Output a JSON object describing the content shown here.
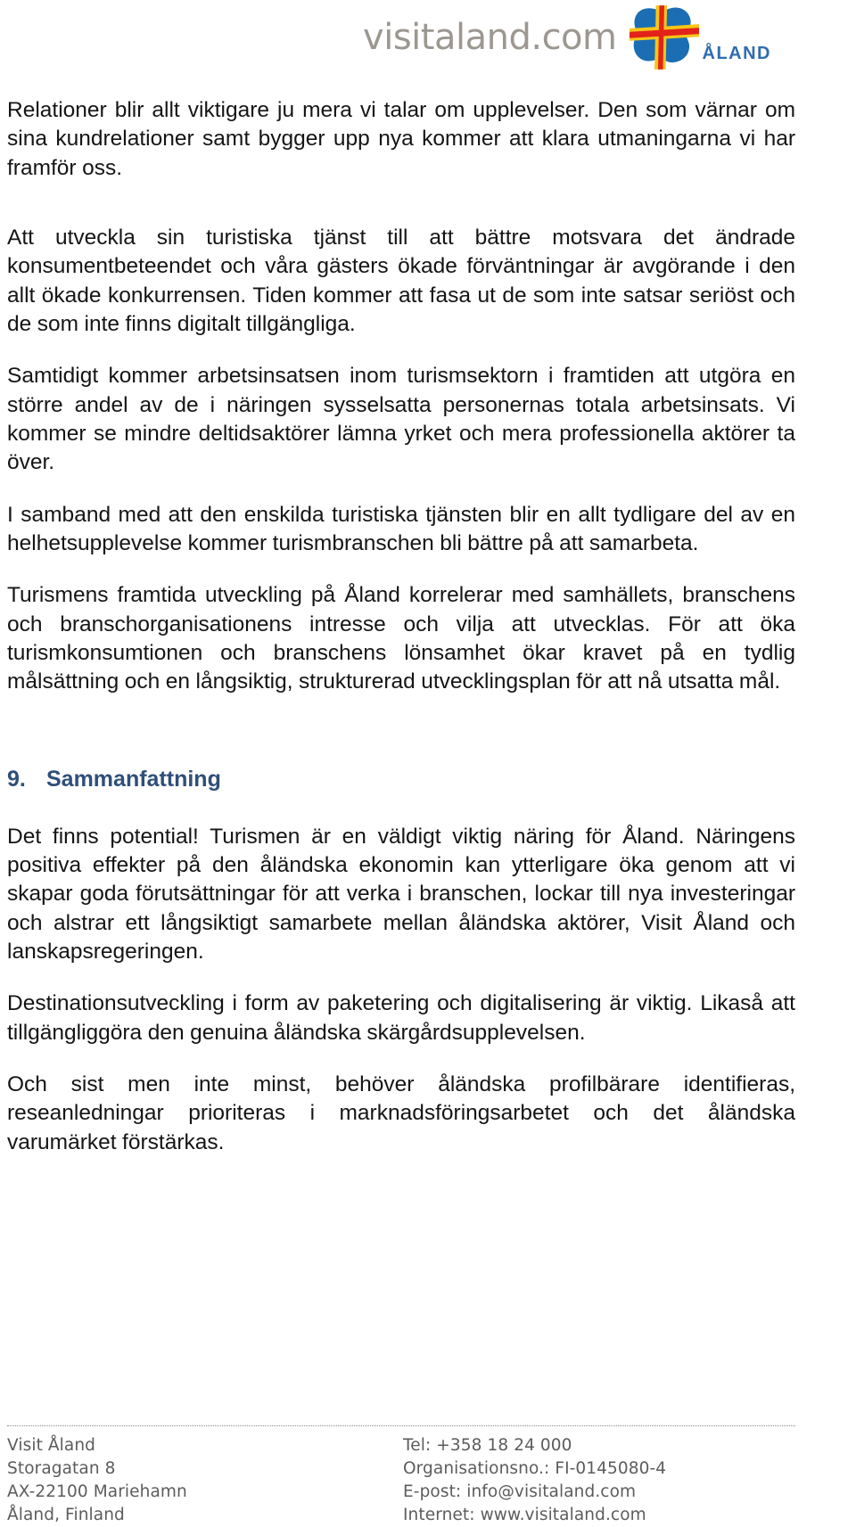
{
  "header": {
    "logo_wordmark": "visitaland.com",
    "emblem_label": "ÅLAND",
    "emblem_colors": {
      "clover_blue": "#1b6eb3",
      "cross_yellow": "#f5c518",
      "cross_red": "#e2231a"
    }
  },
  "colors": {
    "heading_blue": "#2e4f7a",
    "body_text": "#151515",
    "footer_text": "#5c5c5c",
    "wordmark_gray": "#9c9791",
    "emblem_label_blue": "#2f6cb0"
  },
  "content": {
    "paragraphs": [
      "Relationer blir allt viktigare ju mera vi talar om upplevelser. Den som värnar om sina kundrelationer samt bygger upp nya kommer att klara utmaningarna vi har framför oss.",
      "Att utveckla sin turistiska tjänst till att bättre motsvara det ändrade konsumentbeteendet och våra gästers ökade förväntningar är avgörande i den allt ökade konkurrensen. Tiden kommer att fasa ut de som inte satsar seriöst och de som inte finns digitalt tillgängliga.",
      "Samtidigt kommer arbetsinsatsen inom turismsektorn i framtiden att utgöra en större andel av de i näringen sysselsatta personernas totala arbetsinsats. Vi kommer se mindre deltidsaktörer lämna yrket och mera professionella aktörer ta över.",
      "I samband med att den enskilda turistiska tjänsten blir en allt tydligare del av en helhetsupplevelse kommer turismbranschen bli bättre på att samarbeta.",
      "Turismens framtida utveckling på Åland korrelerar med samhällets, branschens och branschorganisationens intresse och vilja att utvecklas. För att öka turismkonsumtionen och branschens lönsamhet ökar kravet på en tydlig målsättning och en långsiktig, strukturerad utvecklingsplan för att nå utsatta mål."
    ],
    "section": {
      "number": "9.",
      "title": "Sammanfattning",
      "paragraphs": [
        "Det finns potential! Turismen är en väldigt viktig näring för Åland. Näringens positiva effekter på den åländska ekonomin kan ytterligare öka genom att vi skapar goda förutsättningar för att verka i branschen, lockar till nya investeringar och alstrar ett långsiktigt samarbete mellan åländska aktörer, Visit Åland och lanskapsregeringen.",
        "Destinationsutveckling i form av paketering och digitalisering är viktig. Likaså att tillgängliggöra den genuina åländska skärgårdsupplevelsen.",
        "Och sist men inte minst, behöver åländska profilbärare identifieras, reseanledningar prioriteras i marknadsföringsarbetet och det åländska varumärket förstärkas."
      ]
    }
  },
  "footer": {
    "left": {
      "line1": "Visit Åland",
      "line2": "Storagatan 8",
      "line3": "AX-22100 Mariehamn",
      "line4": "Åland, Finland"
    },
    "right": {
      "line1": "Tel: +358 18 24 000",
      "line2": "Organisationsno.: FI-0145080-4",
      "line3": "E-post: info@visitaland.com",
      "line4": "Internet: www.visitaland.com"
    }
  }
}
